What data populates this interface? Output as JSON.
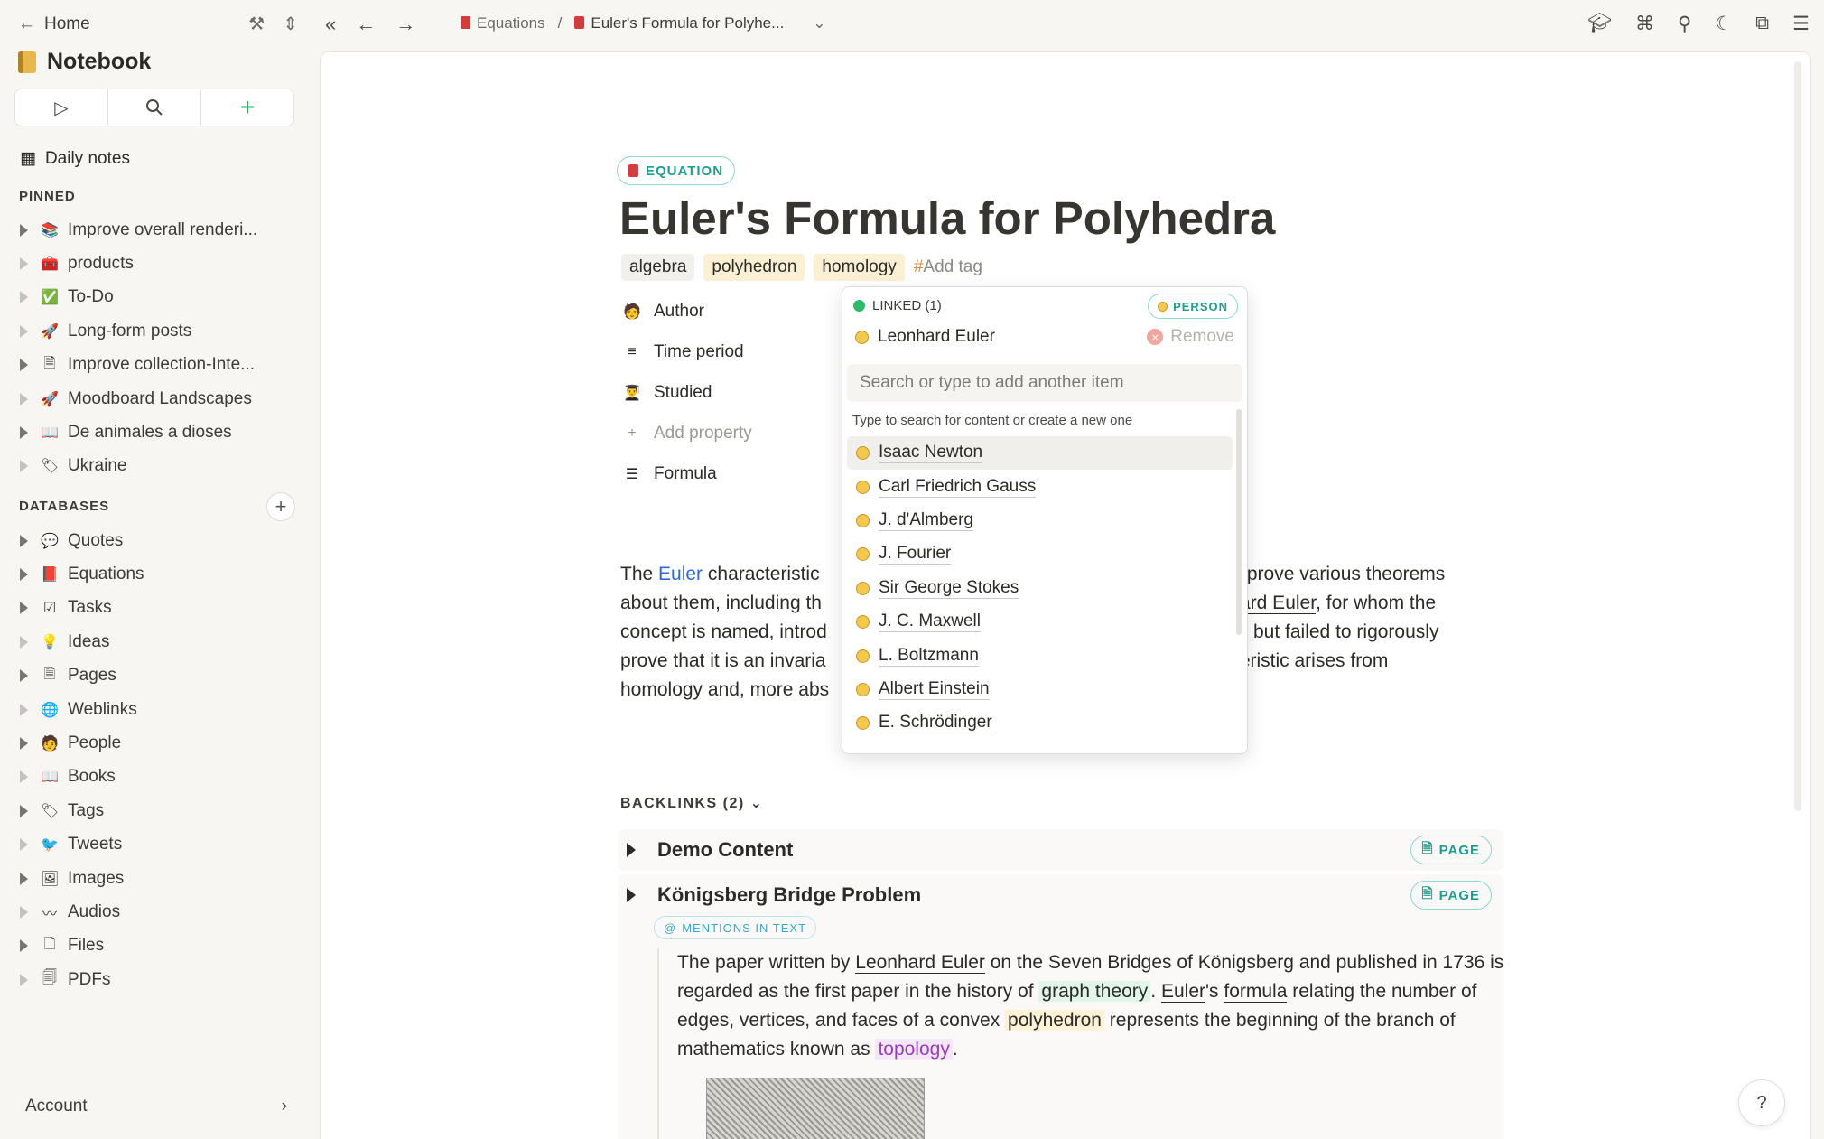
{
  "sidebar": {
    "home_label": "Home",
    "notebook_title": "Notebook",
    "daily_notes": "Daily notes",
    "pinned_label": "PINNED",
    "pinned": [
      {
        "label": "Improve overall renderi...",
        "icon": "books-icon",
        "glyph": "📚",
        "expandable": true
      },
      {
        "label": "products",
        "icon": "toolbox-icon",
        "glyph": "🧰",
        "expandable": false
      },
      {
        "label": "To-Do",
        "icon": "check-icon",
        "glyph": "✅",
        "expandable": false
      },
      {
        "label": "Long-form posts",
        "icon": "rocket-icon",
        "glyph": "🚀",
        "expandable": false
      },
      {
        "label": "Improve collection-Inte...",
        "icon": "page-icon",
        "glyph": "🗎",
        "expandable": true
      },
      {
        "label": "Moodboard Landscapes",
        "icon": "rocket-icon",
        "glyph": "🚀",
        "expandable": false
      },
      {
        "label": "De animales a dioses",
        "icon": "book-open-icon",
        "glyph": "📖",
        "expandable": true
      },
      {
        "label": "Ukraine",
        "icon": "tag-icon",
        "glyph": "🏷",
        "expandable": false
      }
    ],
    "databases_label": "DATABASES",
    "databases": [
      {
        "label": "Quotes",
        "icon": "speech-icon",
        "glyph": "💬"
      },
      {
        "label": "Equations",
        "icon": "red-book-icon",
        "glyph": "📕"
      },
      {
        "label": "Tasks",
        "icon": "checkbox-icon",
        "glyph": "☑"
      },
      {
        "label": "Ideas",
        "icon": "lightbulb-icon",
        "glyph": "💡"
      },
      {
        "label": "Pages",
        "icon": "page-icon",
        "glyph": "🗎"
      },
      {
        "label": "Weblinks",
        "icon": "globe-icon",
        "glyph": "🌐"
      },
      {
        "label": "People",
        "icon": "person-icon",
        "glyph": "🧑"
      },
      {
        "label": "Books",
        "icon": "book-open-icon",
        "glyph": "📖"
      },
      {
        "label": "Tags",
        "icon": "tag-icon",
        "glyph": "🏷"
      },
      {
        "label": "Tweets",
        "icon": "bird-icon",
        "glyph": "🐦"
      },
      {
        "label": "Images",
        "icon": "image-icon",
        "glyph": "🖼"
      },
      {
        "label": "Audios",
        "icon": "waveform-icon",
        "glyph": "〰"
      },
      {
        "label": "Files",
        "icon": "file-icon",
        "glyph": "🗋"
      },
      {
        "label": "PDFs",
        "icon": "pdf-icon",
        "glyph": "🗐"
      }
    ],
    "account_label": "Account"
  },
  "topbar": {
    "crumbs": [
      "Equations",
      "Euler's Formula for Polyhe..."
    ]
  },
  "page": {
    "type_badge": "EQUATION",
    "title": "Euler's Formula for Polyhedra",
    "tags": [
      "algebra",
      "polyhedron",
      "homology"
    ],
    "add_tag": "Add tag",
    "properties": [
      {
        "label": "Author",
        "icon": "person-icon",
        "glyph": "🧑"
      },
      {
        "label": "Time period",
        "icon": "lines-icon",
        "glyph": "≡"
      },
      {
        "label": "Studied",
        "icon": "student-icon",
        "glyph": "👨‍🎓"
      },
      {
        "label": "Add property",
        "icon": "plus-icon",
        "glyph": "+"
      },
      {
        "label": "Formula",
        "icon": "list-icon",
        "glyph": "☰"
      }
    ],
    "body_lines": [
      {
        "a": "The ",
        "link": "Euler",
        "b": " characteristic ",
        "c": "d to prove various theorems"
      },
      {
        "a": "about them, including th",
        "c_ul": "ard Euler",
        "c": ", for whom the"
      },
      {
        "a": "concept is named, introd",
        "c": "but failed to rigorously"
      },
      {
        "a": "prove that it is an invaria",
        "c": "teristic arises from"
      },
      {
        "a": "homology and, more abs",
        "c": ""
      }
    ]
  },
  "backlinks": {
    "label": "BACKLINKS (2)",
    "items": [
      {
        "title": "Demo Content",
        "badge": "PAGE"
      },
      {
        "title": "Königsberg Bridge Problem",
        "badge": "PAGE"
      }
    ],
    "mention_badge": "MENTIONS IN TEXT",
    "quote": {
      "t1": "The paper written by ",
      "u1": "Leonhard Euler",
      "t2": " on the Seven Bridges of Königsberg and published in 1736 is regarded as the first paper in the history of ",
      "h1": "graph theory",
      "t3": ". ",
      "u2": "Euler",
      "t4": "'s ",
      "u3": "formula",
      "t5": " relating the number of edges, vertices, and faces of a convex ",
      "h2": "polyhedron",
      "t6": " represents the beginning of the branch of mathematics known as ",
      "h3": "topology",
      "t7": "."
    }
  },
  "popup": {
    "linked_label": "LINKED (1)",
    "person_badge": "PERSON",
    "linked_item": "Leonhard Euler",
    "remove_label": "Remove",
    "search_placeholder": "Search or type to add another item",
    "hint": "Type to search for content or create a new one",
    "options": [
      "Isaac Newton",
      "Carl Friedrich Gauss",
      "J. d'Almberg",
      "J. Fourier",
      "Sir George Stokes",
      "J. C. Maxwell",
      "L. Boltzmann",
      "Albert Einstein",
      "E. Schrödinger"
    ]
  },
  "help_label": "?"
}
